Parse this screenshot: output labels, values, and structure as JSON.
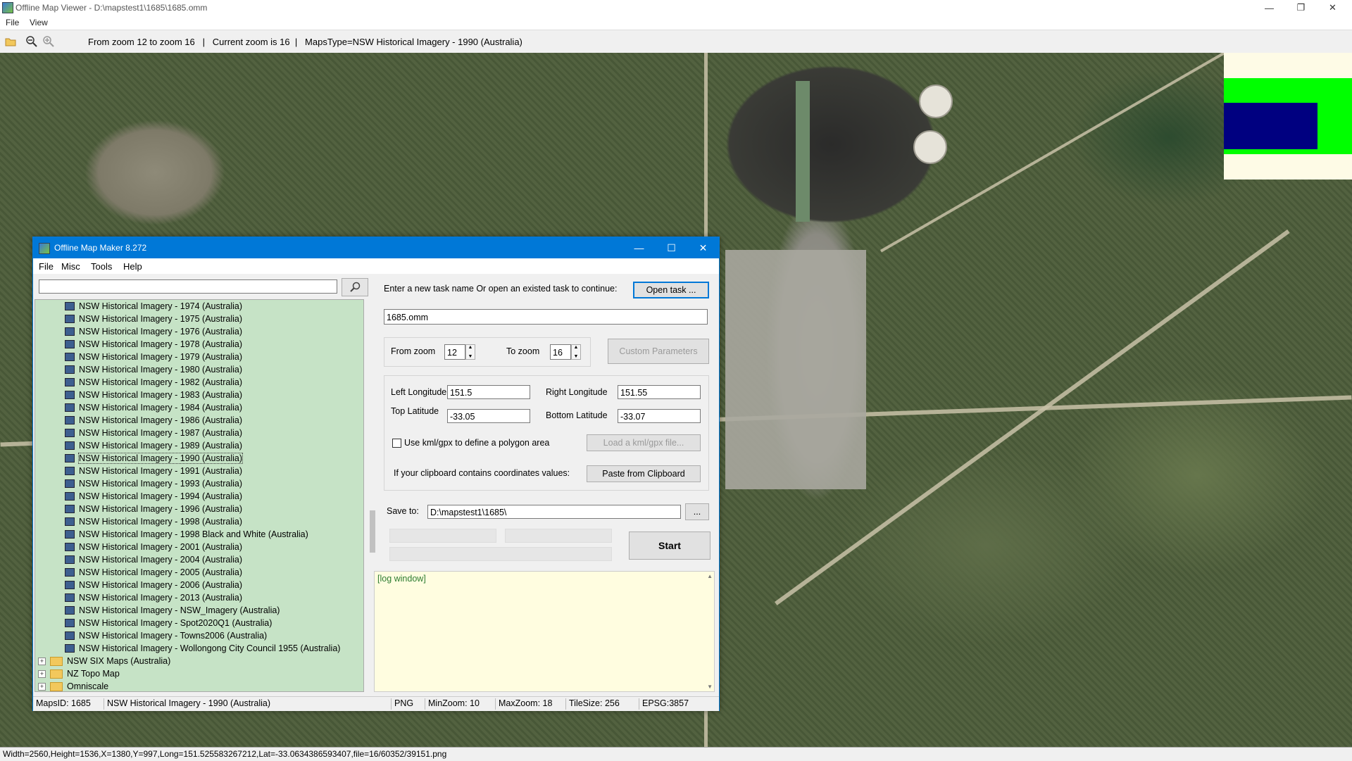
{
  "viewer": {
    "title": "Offline Map Viewer - D:\\mapstest1\\1685\\1685.omm",
    "menu": [
      "File",
      "View"
    ],
    "toolbar_info": "From zoom 12 to zoom 16   |   Current zoom is 16  |   MapsType=NSW Historical Imagery - 1990 (Australia)",
    "toolbar_icons": [
      "open-folder-icon",
      "zoom-out-icon",
      "zoom-in-icon"
    ],
    "status": "Width=2560,Height=1536,X=1380,Y=997,Long=151.525583267212,Lat=-33.0634386593407,file=16/60352/39151.png",
    "legend_colors": [
      "#fefbe6",
      "#00ff00",
      "#000080"
    ]
  },
  "dialog": {
    "title": "Offline Map Maker 8.272",
    "menu": [
      "File",
      "Misc",
      "Tools",
      "Help"
    ],
    "search_value": "",
    "tree_items": [
      "NSW Historical Imagery - 1974 (Australia)",
      "NSW Historical Imagery - 1975 (Australia)",
      "NSW Historical Imagery - 1976 (Australia)",
      "NSW Historical Imagery - 1978 (Australia)",
      "NSW Historical Imagery - 1979 (Australia)",
      "NSW Historical Imagery - 1980 (Australia)",
      "NSW Historical Imagery - 1982 (Australia)",
      "NSW Historical Imagery - 1983 (Australia)",
      "NSW Historical Imagery - 1984 (Australia)",
      "NSW Historical Imagery - 1986 (Australia)",
      "NSW Historical Imagery - 1987 (Australia)",
      "NSW Historical Imagery - 1989 (Australia)",
      "NSW Historical Imagery - 1990 (Australia)",
      "NSW Historical Imagery - 1991 (Australia)",
      "NSW Historical Imagery - 1993 (Australia)",
      "NSW Historical Imagery - 1994 (Australia)",
      "NSW Historical Imagery - 1996 (Australia)",
      "NSW Historical Imagery - 1998 (Australia)",
      "NSW Historical Imagery - 1998 Black and White (Australia)",
      "NSW Historical Imagery - 2001 (Australia)",
      "NSW Historical Imagery - 2004 (Australia)",
      "NSW Historical Imagery - 2005 (Australia)",
      "NSW Historical Imagery - 2006 (Australia)",
      "NSW Historical Imagery - 2013 (Australia)",
      "NSW Historical Imagery - NSW_Imagery (Australia)",
      "NSW Historical Imagery - Spot2020Q1 (Australia)",
      "NSW Historical Imagery - Towns2006 (Australia)",
      "NSW Historical Imagery - Wollongong City Council 1955 (Australia)"
    ],
    "selected_item": "NSW Historical Imagery - 1990 (Australia)",
    "folders": [
      "NSW SIX Maps (Australia)",
      "NZ Topo Map",
      "Omniscale"
    ],
    "task_prompt": "Enter a new task name Or open an existed task to continue:",
    "open_task_label": "Open task ...",
    "task_name": "1685.omm",
    "from_zoom_label": "From zoom",
    "from_zoom": "12",
    "to_zoom_label": "To zoom",
    "to_zoom": "16",
    "custom_params_label": "Custom Parameters",
    "left_lon_label": "Left Longitude",
    "left_lon": "151.5",
    "right_lon_label": "Right Longitude",
    "right_lon": "151.55",
    "top_lat_label": "Top Latitude",
    "top_lat": "-33.05",
    "bottom_lat_label": "Bottom Latitude",
    "bottom_lat": "-33.07",
    "kml_checkbox_label": "Use kml/gpx to define a polygon area",
    "kml_checked": false,
    "load_kml_label": "Load a kml/gpx file...",
    "clipboard_prompt": "If your clipboard contains coordinates values:",
    "paste_label": "Paste from Clipboard",
    "save_to_label": "Save to:",
    "save_to": "D:\\mapstest1\\1685\\",
    "browse_label": "...",
    "start_label": "Start",
    "log_text": "[log window]",
    "status": {
      "maps_id": "MapsID: 1685",
      "maps_name": "NSW Historical Imagery - 1990 (Australia)",
      "format": "PNG",
      "min_zoom": "MinZoom: 10",
      "max_zoom": "MaxZoom: 18",
      "tile_size": "TileSize: 256",
      "epsg": "EPSG:3857"
    }
  }
}
